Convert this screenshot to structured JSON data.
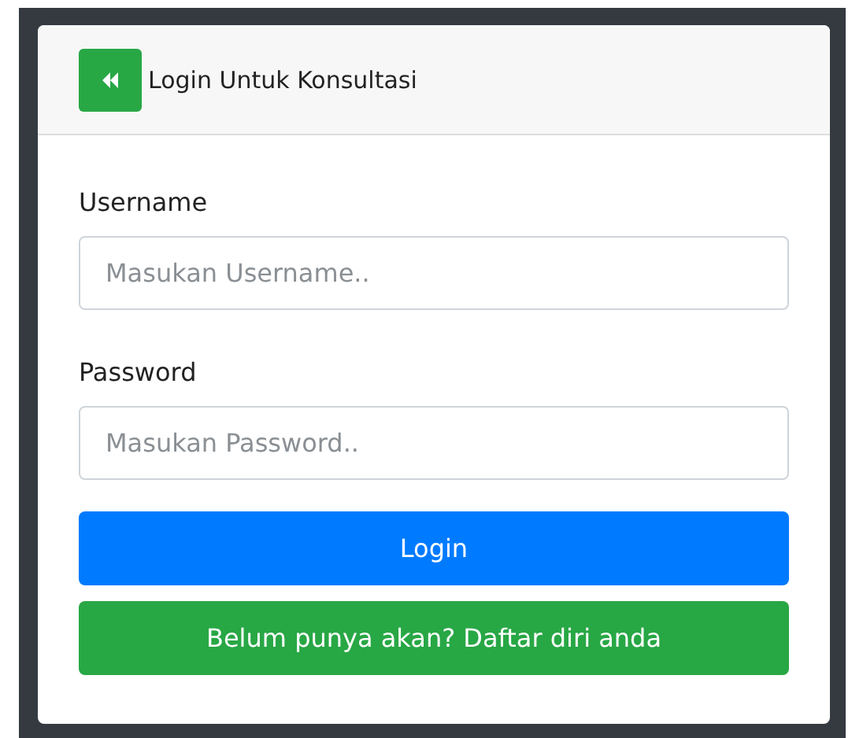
{
  "card": {
    "title": "Login Untuk Konsultasi"
  },
  "fields": [
    {
      "label": "Username",
      "placeholder": "Masukan Username.."
    },
    {
      "label": "Password",
      "placeholder": "Masukan Password.."
    }
  ],
  "buttons": [
    {
      "label": "Login",
      "kind": "primary"
    },
    {
      "label": "Belum punya akan? Daftar diri anda",
      "kind": "success"
    }
  ]
}
